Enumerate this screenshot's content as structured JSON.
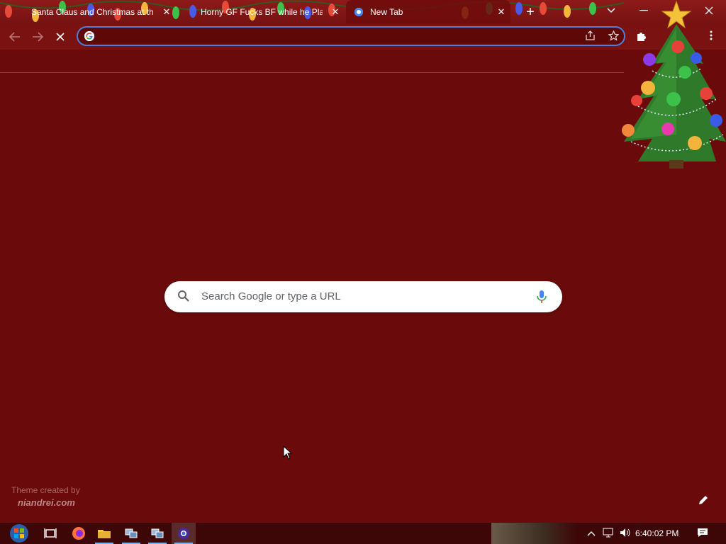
{
  "browser": {
    "tabs": [
      {
        "title": "Santa Claus and Christmas at the",
        "active": false
      },
      {
        "title": "Horny GF Fucks BF while he Play",
        "active": false
      },
      {
        "title": "New Tab",
        "active": true
      }
    ],
    "new_tab_label": "+",
    "omnibox": {
      "value": "",
      "placeholder": ""
    }
  },
  "ntp": {
    "search_placeholder": "Search Google or type a URL",
    "theme_credit_line1": "Theme created by",
    "theme_credit_line2": "niandrei.com"
  },
  "taskbar": {
    "clock": "6:40:02 PM",
    "apps": [
      "start",
      "task-view",
      "firefox",
      "file-explorer",
      "network-app-1",
      "network-app-2",
      "chrome"
    ]
  },
  "colors": {
    "background": "#6b0a0a",
    "omnibox_border": "#4d7fe0",
    "taskbar": "#3e0707"
  }
}
